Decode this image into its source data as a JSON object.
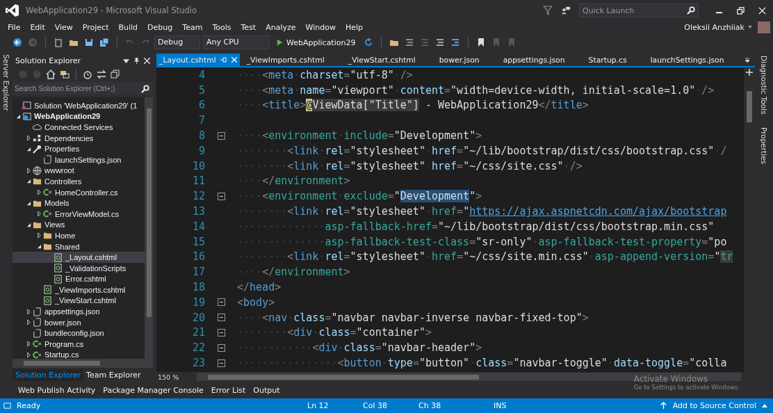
{
  "window": {
    "title": "WebApplication29 - Microsoft Visual Studio",
    "quick_launch": {
      "placeholder": "Quick Launch"
    },
    "user": "Oleksii Anzhiiak"
  },
  "menu": [
    "File",
    "Edit",
    "View",
    "Project",
    "Build",
    "Debug",
    "Team",
    "Tools",
    "Test",
    "Analyze",
    "Window",
    "Help"
  ],
  "toolbar": {
    "configuration": "Debug",
    "platform": "Any CPU",
    "run_target": "WebApplication29"
  },
  "left_strip": "Server Explorer",
  "right_strip": [
    "Diagnostic Tools",
    "Properties"
  ],
  "solution_explorer": {
    "title": "Solution Explorer",
    "search": {
      "placeholder": "Search Solution Explorer (Ctrl+;)"
    },
    "tree": [
      {
        "label": "Solution 'WebApplication29' (1",
        "kind": "solution",
        "selected": false,
        "bold": false
      },
      {
        "label": "WebApplication29",
        "kind": "project",
        "selected": false,
        "bold": true,
        "expanded": true,
        "children": [
          {
            "label": "Connected Services",
            "kind": "cloud",
            "selected": false,
            "bold": false
          },
          {
            "label": "Dependencies",
            "kind": "deps",
            "selected": false,
            "bold": false,
            "expanded": false
          },
          {
            "label": "Properties",
            "kind": "wrench",
            "selected": false,
            "bold": false,
            "expanded": true,
            "children": [
              {
                "label": "launchSettings.json",
                "kind": "json",
                "selected": false,
                "bold": false
              }
            ]
          },
          {
            "label": "wwwroot",
            "kind": "globe",
            "selected": false,
            "bold": false,
            "expanded": false
          },
          {
            "label": "Controllers",
            "kind": "folder",
            "selected": false,
            "bold": false,
            "expanded": true,
            "children": [
              {
                "label": "HomeController.cs",
                "kind": "csharp",
                "selected": false,
                "bold": false,
                "expanded": false
              }
            ]
          },
          {
            "label": "Models",
            "kind": "folder",
            "selected": false,
            "bold": false,
            "expanded": true,
            "children": [
              {
                "label": "ErrorViewModel.cs",
                "kind": "csharp",
                "selected": false,
                "bold": false,
                "expanded": false
              }
            ]
          },
          {
            "label": "Views",
            "kind": "folder",
            "selected": false,
            "bold": false,
            "expanded": true,
            "children": [
              {
                "label": "Home",
                "kind": "folder",
                "selected": false,
                "bold": false,
                "expanded": false
              },
              {
                "label": "Shared",
                "kind": "folder",
                "selected": false,
                "bold": false,
                "expanded": true,
                "children": [
                  {
                    "label": "_Layout.cshtml",
                    "kind": "razor",
                    "selected": true,
                    "bold": false
                  },
                  {
                    "label": "_ValidationScripts",
                    "kind": "razor",
                    "selected": false,
                    "bold": false
                  },
                  {
                    "label": "Error.cshtml",
                    "kind": "razor",
                    "selected": false,
                    "bold": false
                  }
                ]
              },
              {
                "label": "_ViewImports.cshtml",
                "kind": "razor",
                "selected": false,
                "bold": false
              },
              {
                "label": "_ViewStart.cshtml",
                "kind": "razor",
                "selected": false,
                "bold": false
              }
            ]
          },
          {
            "label": "appsettings.json",
            "kind": "json",
            "selected": false,
            "bold": false,
            "expanded": false
          },
          {
            "label": "bower.json",
            "kind": "json",
            "selected": false,
            "bold": false,
            "expanded": false
          },
          {
            "label": "bundleconfig.json",
            "kind": "json",
            "selected": false,
            "bold": false
          },
          {
            "label": "Program.cs",
            "kind": "csharp",
            "selected": false,
            "bold": false,
            "expanded": false
          },
          {
            "label": "Startup.cs",
            "kind": "csharp",
            "selected": false,
            "bold": false,
            "expanded": false
          }
        ]
      }
    ],
    "tabs": [
      {
        "label": "Solution Explorer",
        "selected": true
      },
      {
        "label": "Team Explorer",
        "selected": false
      }
    ]
  },
  "document_tabs": [
    {
      "label": "_Layout.cshtml",
      "selected": true
    },
    {
      "label": "_ViewImports.cshtml",
      "selected": false
    },
    {
      "label": "_ViewStart.cshtml",
      "selected": false
    },
    {
      "label": "bower.json",
      "selected": false
    },
    {
      "label": "appsettings.json",
      "selected": false
    },
    {
      "label": "Startup.cs",
      "selected": false
    },
    {
      "label": "launchSettings.json",
      "selected": false
    }
  ],
  "editor": {
    "zoom": "150 %",
    "lines": [
      {
        "number": "4",
        "fold": false,
        "tokens": [
          {
            "kind": "ws",
            "text": "····"
          },
          {
            "kind": "punct",
            "text": "<"
          },
          {
            "kind": "tag",
            "text": "meta"
          },
          {
            "kind": "ws",
            "text": "·"
          },
          {
            "kind": "attr",
            "text": "charset"
          },
          {
            "kind": "punct",
            "text": "="
          },
          {
            "kind": "string",
            "text": "\"utf-8\""
          },
          {
            "kind": "ws",
            "text": "·"
          },
          {
            "kind": "punct",
            "text": "/>"
          }
        ]
      },
      {
        "number": "5",
        "fold": false,
        "tokens": [
          {
            "kind": "ws",
            "text": "····"
          },
          {
            "kind": "punct",
            "text": "<"
          },
          {
            "kind": "tag",
            "text": "meta"
          },
          {
            "kind": "ws",
            "text": "·"
          },
          {
            "kind": "attr",
            "text": "name"
          },
          {
            "kind": "punct",
            "text": "="
          },
          {
            "kind": "string",
            "text": "\"viewport\""
          },
          {
            "kind": "ws",
            "text": "·"
          },
          {
            "kind": "attr",
            "text": "content"
          },
          {
            "kind": "punct",
            "text": "="
          },
          {
            "kind": "string",
            "text": "\"width=device-width, initial-scale=1.0\""
          },
          {
            "kind": "ws",
            "text": "·"
          },
          {
            "kind": "punct",
            "text": "/>"
          }
        ]
      },
      {
        "number": "6",
        "fold": false,
        "tokens": [
          {
            "kind": "ws",
            "text": "····"
          },
          {
            "kind": "punct",
            "text": "<"
          },
          {
            "kind": "tag",
            "text": "title"
          },
          {
            "kind": "punct",
            "text": ">"
          },
          {
            "kind": "razor-at",
            "text": "@"
          },
          {
            "kind": "razor",
            "text": "ViewData[\"Title\"]"
          },
          {
            "kind": "text",
            "text": " - WebApplication29"
          },
          {
            "kind": "punct",
            "text": "</"
          },
          {
            "kind": "tag",
            "text": "title"
          },
          {
            "kind": "punct",
            "text": ">"
          }
        ]
      },
      {
        "number": "7",
        "fold": false
      },
      {
        "number": "8",
        "fold": true,
        "tokens": [
          {
            "kind": "ws",
            "text": "····"
          },
          {
            "kind": "punct",
            "text": "<"
          },
          {
            "kind": "helper",
            "text": "environment"
          },
          {
            "kind": "ws",
            "text": "·"
          },
          {
            "kind": "helper",
            "text": "include"
          },
          {
            "kind": "punct",
            "text": "="
          },
          {
            "kind": "string",
            "text": "\"Development\""
          },
          {
            "kind": "punct",
            "text": ">"
          }
        ]
      },
      {
        "number": "9",
        "fold": false,
        "tokens": [
          {
            "kind": "ws",
            "text": "········"
          },
          {
            "kind": "punct",
            "text": "<"
          },
          {
            "kind": "tag",
            "text": "link"
          },
          {
            "kind": "ws",
            "text": "·"
          },
          {
            "kind": "attr",
            "text": "rel"
          },
          {
            "kind": "punct",
            "text": "="
          },
          {
            "kind": "string",
            "text": "\"stylesheet\""
          },
          {
            "kind": "ws",
            "text": "·"
          },
          {
            "kind": "attr",
            "text": "href"
          },
          {
            "kind": "punct",
            "text": "="
          },
          {
            "kind": "string",
            "text": "\"~/lib/bootstrap/dist/css/bootstrap.css\""
          },
          {
            "kind": "ws",
            "text": "·"
          },
          {
            "kind": "punct",
            "text": "/"
          }
        ]
      },
      {
        "number": "10",
        "fold": false,
        "tokens": [
          {
            "kind": "ws",
            "text": "········"
          },
          {
            "kind": "punct",
            "text": "<"
          },
          {
            "kind": "tag",
            "text": "link"
          },
          {
            "kind": "ws",
            "text": "·"
          },
          {
            "kind": "attr",
            "text": "rel"
          },
          {
            "kind": "punct",
            "text": "="
          },
          {
            "kind": "string",
            "text": "\"stylesheet\""
          },
          {
            "kind": "ws",
            "text": "·"
          },
          {
            "kind": "attr",
            "text": "href"
          },
          {
            "kind": "punct",
            "text": "="
          },
          {
            "kind": "string",
            "text": "\"~/css/site.css\""
          },
          {
            "kind": "ws",
            "text": "·"
          },
          {
            "kind": "punct",
            "text": "/>"
          }
        ]
      },
      {
        "number": "11",
        "fold": false,
        "tokens": [
          {
            "kind": "ws",
            "text": "····"
          },
          {
            "kind": "punct",
            "text": "</"
          },
          {
            "kind": "helper",
            "text": "environment"
          },
          {
            "kind": "punct",
            "text": ">"
          }
        ]
      },
      {
        "number": "12",
        "fold": true,
        "tokens": [
          {
            "kind": "ws",
            "text": "····"
          },
          {
            "kind": "punct",
            "text": "<"
          },
          {
            "kind": "helper",
            "text": "environment"
          },
          {
            "kind": "ws",
            "text": "·"
          },
          {
            "kind": "helper",
            "text": "exclude"
          },
          {
            "kind": "punct",
            "text": "="
          },
          {
            "kind": "string",
            "text": "\""
          },
          {
            "kind": "selection",
            "text": "Development"
          },
          {
            "kind": "string",
            "text": "\""
          },
          {
            "kind": "punct",
            "text": ">"
          }
        ]
      },
      {
        "number": "13",
        "fold": false,
        "tokens": [
          {
            "kind": "ws",
            "text": "········"
          },
          {
            "kind": "punct",
            "text": "<"
          },
          {
            "kind": "tag",
            "text": "link"
          },
          {
            "kind": "ws",
            "text": "·"
          },
          {
            "kind": "attr",
            "text": "rel"
          },
          {
            "kind": "punct",
            "text": "="
          },
          {
            "kind": "string",
            "text": "\"stylesheet\""
          },
          {
            "kind": "ws",
            "text": "·"
          },
          {
            "kind": "helper",
            "text": "href"
          },
          {
            "kind": "punct",
            "text": "="
          },
          {
            "kind": "string",
            "text": "\""
          },
          {
            "kind": "link",
            "text": "https://ajax.aspnetcdn.com/ajax/bootstrap"
          }
        ]
      },
      {
        "number": "14",
        "fold": false,
        "tokens": [
          {
            "kind": "ws",
            "text": "··············"
          },
          {
            "kind": "helper",
            "text": "asp-fallback-href"
          },
          {
            "kind": "punct",
            "text": "="
          },
          {
            "kind": "string",
            "text": "\"~/lib/bootstrap/dist/css/bootstrap.min.css\""
          }
        ]
      },
      {
        "number": "15",
        "fold": false,
        "tokens": [
          {
            "kind": "ws",
            "text": "··············"
          },
          {
            "kind": "helper",
            "text": "asp-fallback-test-class"
          },
          {
            "kind": "punct",
            "text": "="
          },
          {
            "kind": "string",
            "text": "\"sr-only\""
          },
          {
            "kind": "ws",
            "text": "·"
          },
          {
            "kind": "helper",
            "text": "asp-fallback-test-property"
          },
          {
            "kind": "punct",
            "text": "="
          },
          {
            "kind": "string",
            "text": "\"po"
          }
        ]
      },
      {
        "number": "16",
        "fold": false,
        "tokens": [
          {
            "kind": "ws",
            "text": "········"
          },
          {
            "kind": "punct",
            "text": "<"
          },
          {
            "kind": "tag",
            "text": "link"
          },
          {
            "kind": "ws",
            "text": "·"
          },
          {
            "kind": "attr",
            "text": "rel"
          },
          {
            "kind": "punct",
            "text": "="
          },
          {
            "kind": "string",
            "text": "\"stylesheet\""
          },
          {
            "kind": "ws",
            "text": "·"
          },
          {
            "kind": "helper",
            "text": "href"
          },
          {
            "kind": "punct",
            "text": "="
          },
          {
            "kind": "string",
            "text": "\"~/css/site.min.css\""
          },
          {
            "kind": "ws",
            "text": "·"
          },
          {
            "kind": "helper",
            "text": "asp-append-version"
          },
          {
            "kind": "punct",
            "text": "="
          },
          {
            "kind": "string",
            "text": "\""
          },
          {
            "kind": "razor-helper",
            "text": "tr"
          }
        ]
      },
      {
        "number": "17",
        "fold": false,
        "tokens": [
          {
            "kind": "ws",
            "text": "····"
          },
          {
            "kind": "punct",
            "text": "</"
          },
          {
            "kind": "helper",
            "text": "environment"
          },
          {
            "kind": "punct",
            "text": ">"
          }
        ]
      },
      {
        "number": "18",
        "fold": false,
        "tokens": [
          {
            "kind": "punct",
            "text": "</"
          },
          {
            "kind": "tag",
            "text": "head"
          },
          {
            "kind": "punct",
            "text": ">"
          }
        ]
      },
      {
        "number": "19",
        "fold": true,
        "tokens": [
          {
            "kind": "punct",
            "text": "<"
          },
          {
            "kind": "tag",
            "text": "body"
          },
          {
            "kind": "punct",
            "text": ">"
          }
        ]
      },
      {
        "number": "20",
        "fold": true,
        "tokens": [
          {
            "kind": "ws",
            "text": "····"
          },
          {
            "kind": "punct",
            "text": "<"
          },
          {
            "kind": "tag",
            "text": "nav"
          },
          {
            "kind": "ws",
            "text": "·"
          },
          {
            "kind": "attr",
            "text": "class"
          },
          {
            "kind": "punct",
            "text": "="
          },
          {
            "kind": "string",
            "text": "\"navbar navbar-inverse navbar-fixed-top\""
          },
          {
            "kind": "punct",
            "text": ">"
          }
        ]
      },
      {
        "number": "21",
        "fold": true,
        "tokens": [
          {
            "kind": "ws",
            "text": "········"
          },
          {
            "kind": "punct",
            "text": "<"
          },
          {
            "kind": "tag",
            "text": "div"
          },
          {
            "kind": "ws",
            "text": "·"
          },
          {
            "kind": "attr",
            "text": "class"
          },
          {
            "kind": "punct",
            "text": "="
          },
          {
            "kind": "string",
            "text": "\"container\""
          },
          {
            "kind": "punct",
            "text": ">"
          }
        ]
      },
      {
        "number": "22",
        "fold": true,
        "tokens": [
          {
            "kind": "ws",
            "text": "············"
          },
          {
            "kind": "punct",
            "text": "<"
          },
          {
            "kind": "tag",
            "text": "div"
          },
          {
            "kind": "ws",
            "text": "·"
          },
          {
            "kind": "attr",
            "text": "class"
          },
          {
            "kind": "punct",
            "text": "="
          },
          {
            "kind": "string",
            "text": "\"navbar-header\""
          },
          {
            "kind": "punct",
            "text": ">"
          }
        ]
      },
      {
        "number": "23",
        "fold": true,
        "tokens": [
          {
            "kind": "ws",
            "text": "················"
          },
          {
            "kind": "punct",
            "text": "<"
          },
          {
            "kind": "tag",
            "text": "button"
          },
          {
            "kind": "ws",
            "text": "·"
          },
          {
            "kind": "attr",
            "text": "type"
          },
          {
            "kind": "punct",
            "text": "="
          },
          {
            "kind": "string",
            "text": "\"button\""
          },
          {
            "kind": "ws",
            "text": "·"
          },
          {
            "kind": "attr",
            "text": "class"
          },
          {
            "kind": "punct",
            "text": "="
          },
          {
            "kind": "string",
            "text": "\"navbar-toggle\""
          },
          {
            "kind": "ws",
            "text": "·"
          },
          {
            "kind": "attr",
            "text": "data-toggle"
          },
          {
            "kind": "punct",
            "text": "="
          },
          {
            "kind": "string",
            "text": "\"colla"
          }
        ]
      }
    ]
  },
  "os_notice": {
    "title": "Activate Windows",
    "text": "Go to Settings to activate Windows."
  },
  "tool_tabs": [
    "Web Publish Activity",
    "Package Manager Console",
    "Error List",
    "Output"
  ],
  "status_bar": {
    "state": "Ready",
    "line": "Ln 12",
    "column": "Col 38",
    "char": "Ch 38",
    "mode": "INS",
    "source_control": "Add to Source Control"
  }
}
